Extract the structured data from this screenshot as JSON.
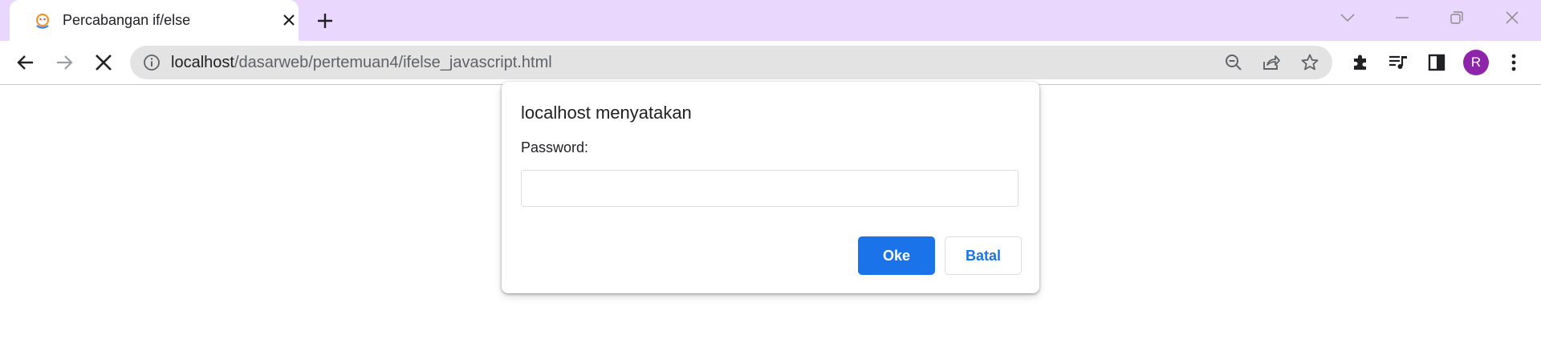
{
  "browser": {
    "tab": {
      "title": "Percabangan if/else"
    },
    "address_bar": {
      "host": "localhost",
      "path": "/dasarweb/pertemuan4/ifelse_javascript.html"
    },
    "profile_initial": "R",
    "colors": {
      "tabstrip": "#e9d7fe",
      "omnibox": "#e3e3e3",
      "avatar": "#8e24aa",
      "accent": "#1a73e8"
    },
    "icons": {
      "tab": [
        "favicon-icon",
        "close-icon"
      ],
      "tabstrip": [
        "new-tab-icon",
        "tab-search-icon",
        "minimize-icon",
        "restore-icon",
        "window-close-icon"
      ],
      "toolbar": [
        "back-icon",
        "forward-icon",
        "stop-icon",
        "info-icon",
        "zoom-out-icon",
        "share-icon",
        "star-icon",
        "extensions-icon",
        "media-icon",
        "side-panel-icon",
        "menu-icon"
      ]
    }
  },
  "dialog": {
    "title": "localhost menyatakan",
    "message": "Password:",
    "input_value": "",
    "ok_label": "Oke",
    "cancel_label": "Batal"
  }
}
